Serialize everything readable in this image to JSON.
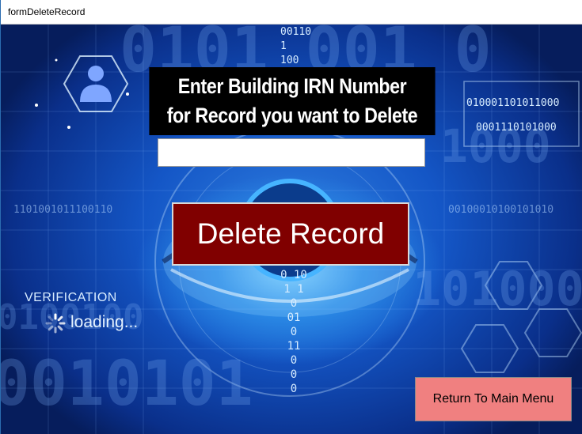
{
  "window": {
    "title": "formDeleteRecord"
  },
  "form": {
    "prompt_line1": "Enter Building IRN Number",
    "prompt_line2": "for Record you want to Delete",
    "irn_value": "",
    "delete_label": "Delete Record",
    "return_label": "Return To Main Menu"
  },
  "background": {
    "verification_text": "VERIFICATION",
    "loading_text": "loading...",
    "binary_top": [
      "00110",
      "1",
      "100"
    ],
    "binary_right_1": "010001101011000",
    "binary_right_2": "0001110101000",
    "binary_left_row": "1101001011100110",
    "binary_right_row": "00100010100101010",
    "binary_center_col": [
      "0 10",
      "1  1",
      "0",
      "01",
      "0",
      "11",
      "0",
      "0",
      "0"
    ],
    "binary_big_bottom": "0010101",
    "binary_big_right": "101000",
    "binary_big_top": "0101 001 0",
    "binary_big_left": "0100100",
    "binary_big_right_top": "1000",
    "icons": {
      "user_icon": "user-hexagon-icon",
      "spinner": "loading-spinner-icon"
    },
    "colors": {
      "delete_button": "#800000",
      "return_button": "#f08080",
      "prompt_background": "#000000"
    }
  }
}
